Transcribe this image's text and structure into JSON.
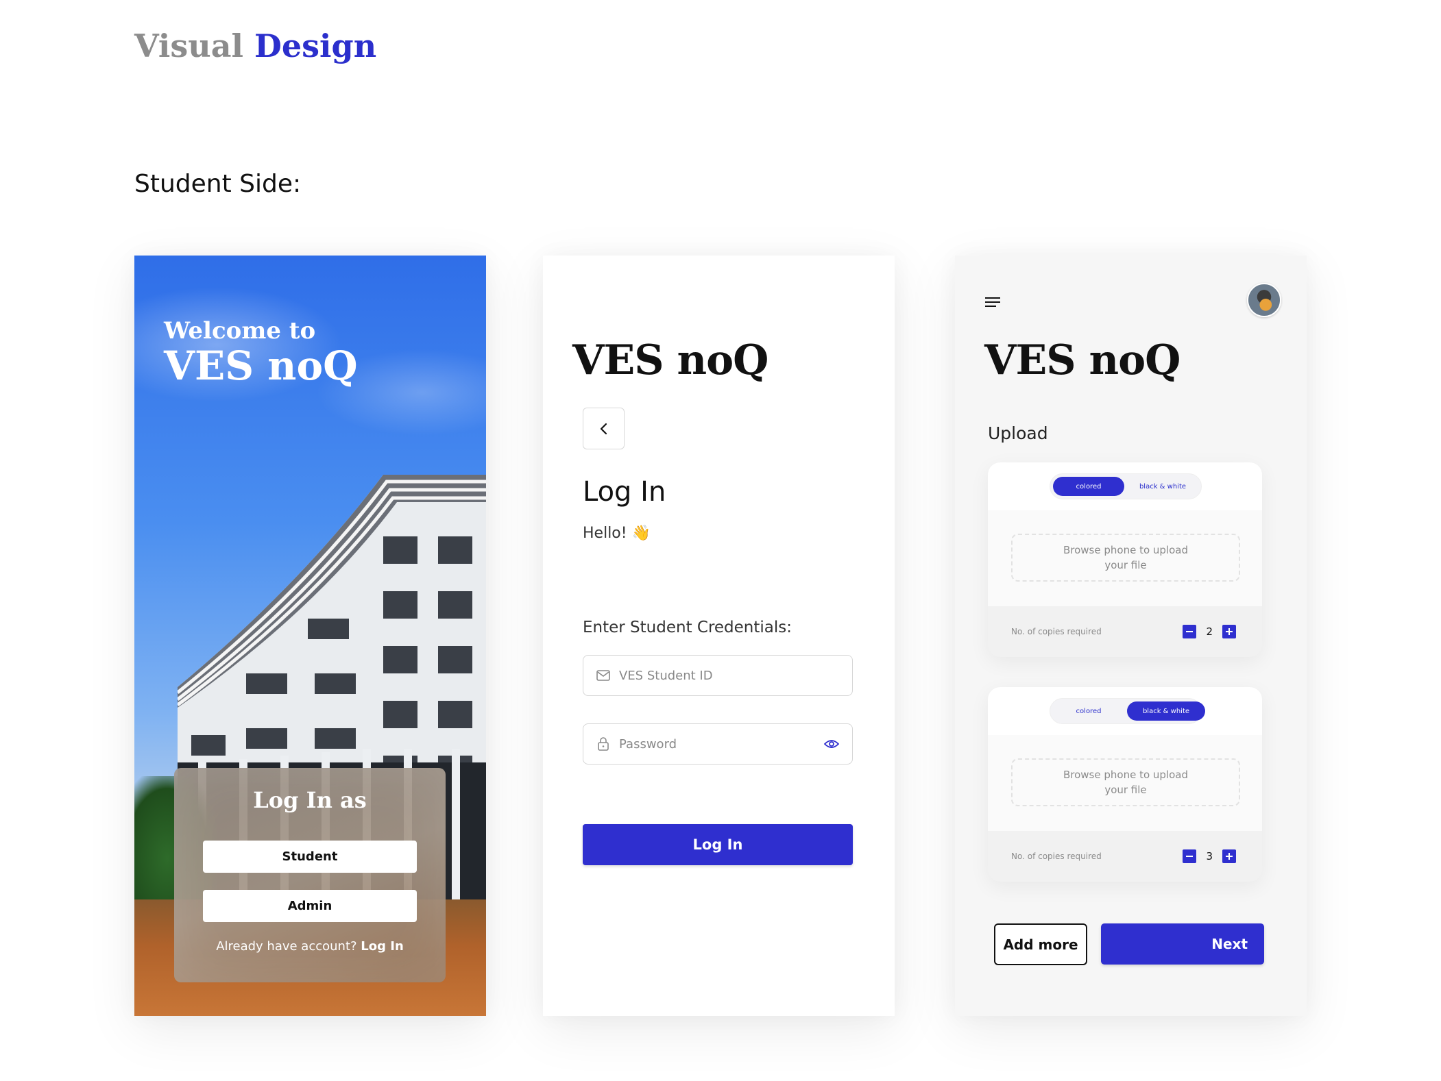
{
  "page": {
    "title_part1": "Visual",
    "title_part2": "Design",
    "section_label": "Student Side:"
  },
  "colors": {
    "accent": "#2f2fcf",
    "title_grey": "#8c8c8c",
    "title_blue": "#2b2fcc"
  },
  "welcome_screen": {
    "welcome_line": "Welcome to",
    "brand": "VES noQ",
    "panel_title": "Log In as",
    "student_button": "Student",
    "admin_button": "Admin",
    "footer_text": "Already have account?",
    "footer_link": "Log In"
  },
  "login_screen": {
    "brand": "VES noQ",
    "back_icon": "chevron-left-icon",
    "heading": "Log In",
    "greeting": "Hello! 👋",
    "credentials_label": "Enter Student Credentials:",
    "student_id_placeholder": "VES Student ID",
    "password_placeholder": "Password",
    "submit_label": "Log In"
  },
  "upload_screen": {
    "brand": "VES noQ",
    "section_label": "Upload",
    "cards": [
      {
        "options": [
          "colored",
          "black & white"
        ],
        "selected": "colored",
        "drop_text": "Browse phone to upload\nyour file",
        "copies_label": "No. of copies required",
        "copies": "2"
      },
      {
        "options": [
          "colored",
          "black & white"
        ],
        "selected": "black & white",
        "drop_text": "Browse phone to upload\nyour file",
        "copies_label": "No. of copies required",
        "copies": "3"
      }
    ],
    "add_more_label": "Add more",
    "next_label": "Next"
  }
}
